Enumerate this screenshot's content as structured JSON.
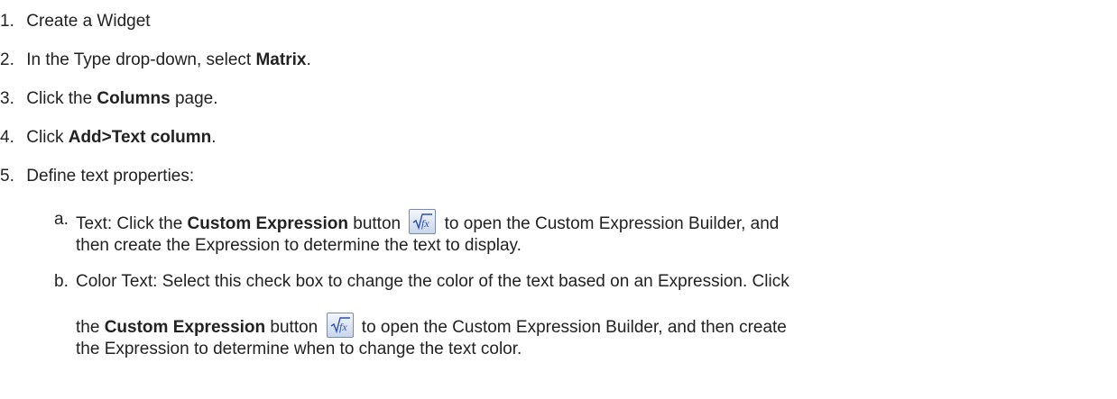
{
  "steps": [
    {
      "num": "1.",
      "text": "Create a Widget"
    },
    {
      "num": "2.",
      "pre": "In the Type drop-down, select ",
      "bold": "Matrix",
      "post": "."
    },
    {
      "num": "3.",
      "pre": "Click the ",
      "bold": "Columns",
      "post": " page."
    },
    {
      "num": "4.",
      "pre": "Click ",
      "bold": "Add>Text column",
      "post": "."
    },
    {
      "num": "5.",
      "text": "Define text properties:"
    }
  ],
  "substeps": {
    "a": {
      "letter": "a.",
      "pre": "Text: Click the ",
      "bold": "Custom Expression",
      "mid": " button",
      "post": " to open the Custom Expression Builder, and",
      "line2": "then create the Expression to determine the text to display."
    },
    "b": {
      "letter": "b.",
      "line1": "Color Text: Select this check box to change the color of the text based on an Expression. Click",
      "pre": "the ",
      "bold": "Custom Expression",
      "mid": " button",
      "post": " to open the Custom Expression Builder, and then create",
      "line3": "the Expression to determine when to change the text color."
    }
  },
  "icons": {
    "custom_expression": "sqrt-fx-icon"
  },
  "colors": {
    "text": "#222222",
    "icon_fx": "#2a4fb0"
  }
}
